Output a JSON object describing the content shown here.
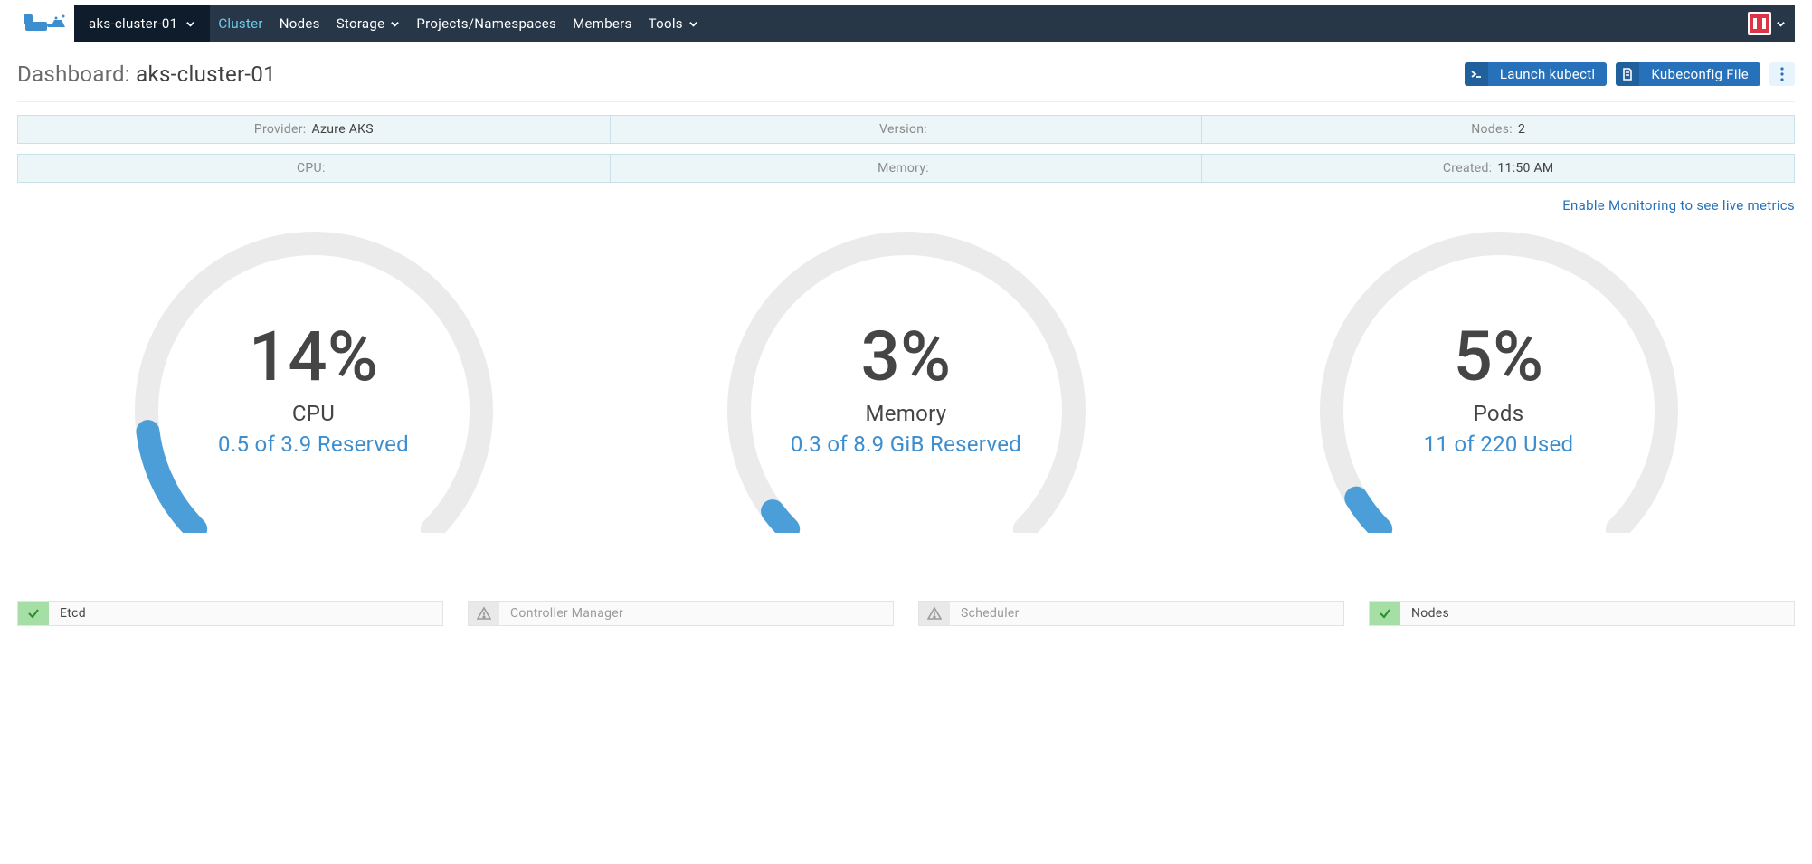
{
  "toolbar": {
    "cluster_dd_label": "aks-cluster-01",
    "nav": [
      "Cluster",
      "Nodes",
      "Storage",
      "Projects/Namespaces",
      "Members",
      "Tools"
    ]
  },
  "header": {
    "title_prefix": "Dashboard: ",
    "title_name": "aks-cluster-01",
    "launch_kubectl": "Launch kubectl",
    "kubeconfig": "Kubeconfig File"
  },
  "info1": {
    "provider_k": "Provider:",
    "provider_v": "Azure AKS",
    "version_k": "Version:",
    "version_v": "",
    "nodes_k": "Nodes:",
    "nodes_v": "2"
  },
  "info2": {
    "cpu_k": "CPU:",
    "cpu_v": "",
    "mem_k": "Memory:",
    "mem_v": "",
    "created_k": "Created:",
    "created_v": "11:50 AM"
  },
  "monitor_link": "Enable Monitoring to see live metrics",
  "gauges": {
    "cpu": {
      "pct": "14%",
      "name": "CPU",
      "sub": "0.5 of 3.9 Reserved",
      "frac": 0.14
    },
    "mem": {
      "pct": "3%",
      "name": "Memory",
      "sub": "0.3 of 8.9 GiB Reserved",
      "frac": 0.03
    },
    "pods": {
      "pct": "5%",
      "name": "Pods",
      "sub": "11 of 220 Used",
      "frac": 0.05
    }
  },
  "health": {
    "etcd": "Etcd",
    "controller": "Controller Manager",
    "scheduler": "Scheduler",
    "nodes": "Nodes"
  }
}
